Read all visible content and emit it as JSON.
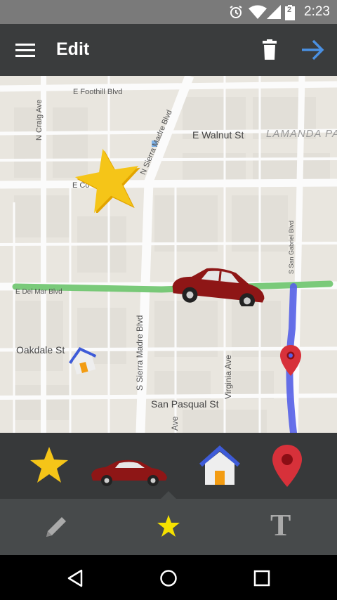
{
  "status_bar": {
    "time": "2:23",
    "icons": [
      "alarm-icon",
      "wifi-icon",
      "signal-icon",
      "battery-icon"
    ],
    "battery_level": "2"
  },
  "app_bar": {
    "title": "Edit",
    "icons": [
      "menu-icon",
      "trash-icon",
      "arrow-forward-icon"
    ],
    "accent_color": "#4a90e2"
  },
  "map": {
    "labels": {
      "foothill": "E Foothill Blvd",
      "craig": "N Craig Ave",
      "sierra_madre_n": "N Sierra Madre Blvd",
      "walnut": "E Walnut St",
      "lamanda": "LAMANDA PAR",
      "colorado": "E Co",
      "delmar": "E Del Mar Blvd",
      "san_gabriel": "S San Gabriel Blvd",
      "oakdale": "Oakdale St",
      "sierra_madre_s": "S Sierra Madre Blvd",
      "virginia": "Virginia Ave",
      "san_pasqual": "San Pasqual St",
      "ave": "Ave"
    },
    "route_colors": {
      "green": "#6cc46c",
      "blue": "#5561e8"
    },
    "stickers": [
      "star-sticker",
      "car-sticker",
      "home-sticker",
      "pin-sticker"
    ]
  },
  "palette": {
    "items": [
      "star",
      "car",
      "home",
      "pin"
    ]
  },
  "tools": {
    "items": [
      "pencil",
      "star",
      "text"
    ],
    "selected": "star",
    "text_glyph": "T"
  },
  "nav_bar": {
    "items": [
      "back",
      "home",
      "recents"
    ]
  }
}
